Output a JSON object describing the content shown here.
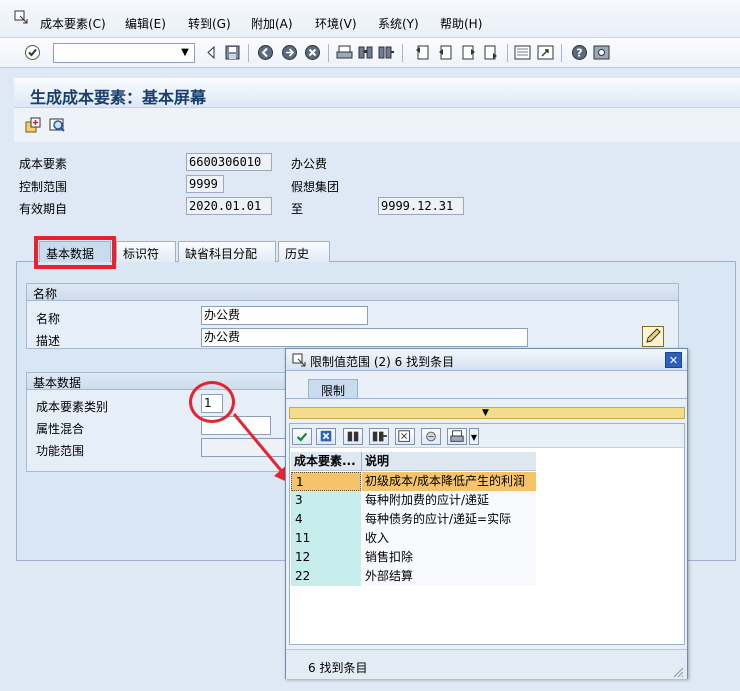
{
  "menu": {
    "items": [
      "成本要素(C)",
      "编辑(E)",
      "转到(G)",
      "附加(A)",
      "环境(V)",
      "系统(Y)",
      "帮助(H)"
    ]
  },
  "toolbar": {
    "command_field_value": "",
    "icons": [
      "enter-icon",
      "back-icon",
      "save-icon",
      "back-nav-icon",
      "exit-icon",
      "cancel-icon",
      "print-icon",
      "find-icon",
      "find-next-icon",
      "first-page-icon",
      "prev-page-icon",
      "next-page-icon",
      "last-page-icon",
      "new-session-icon",
      "shortcut-icon",
      "help-icon",
      "customize-icon"
    ]
  },
  "page": {
    "title": "生成成本要素：基本屏幕"
  },
  "header_fields": {
    "cost_element_label": "成本要素",
    "cost_element_value": "6600306010",
    "cost_element_text": "办公费",
    "controlling_area_label": "控制范围",
    "controlling_area_value": "9999",
    "controlling_area_text": "假想集团",
    "valid_from_label": "有效期自",
    "valid_from_value": "2020.01.01",
    "valid_to_label": "至",
    "valid_to_value": "9999.12.31"
  },
  "tabs": [
    {
      "label": "基本数据",
      "active": true
    },
    {
      "label": "标识符",
      "active": false
    },
    {
      "label": "缺省科目分配",
      "active": false
    },
    {
      "label": "历史",
      "active": false
    }
  ],
  "names_group": {
    "title": "名称",
    "name_label": "名称",
    "name_value": "办公费",
    "desc_label": "描述",
    "desc_value": "办公费"
  },
  "basic_group": {
    "title": "基本数据",
    "category_label": "成本要素类别",
    "category_value": "1",
    "attribute_label": "属性混合",
    "attribute_value": "",
    "func_area_label": "功能范围",
    "func_area_value": ""
  },
  "popup": {
    "title": "限制值范围 (2)   6 找到条目",
    "tab_label": "限制",
    "col_key": "成本要素...",
    "col_desc": "说明",
    "rows": [
      {
        "key": "1",
        "desc": "初级成本/成本降低产生的利润"
      },
      {
        "key": "3",
        "desc": "每种附加费的应计/递延"
      },
      {
        "key": "4",
        "desc": "每种债务的应计/递延=实际"
      },
      {
        "key": "11",
        "desc": "收入"
      },
      {
        "key": "12",
        "desc": "销售扣除"
      },
      {
        "key": "22",
        "desc": "外部结算"
      }
    ],
    "selected_row": 0,
    "status": "6 找到条目",
    "close_glyph": "✕"
  },
  "colors": {
    "highlight_red": "#e8222e",
    "key_column": "#c7ecec",
    "selected_row": "#f4c36a"
  }
}
